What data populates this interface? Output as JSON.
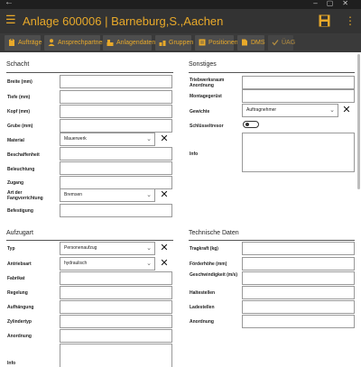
{
  "window": {
    "back_glyph": "←"
  },
  "appbar": {
    "title": "Anlage 600006  |  Barneburg,S.,Aachen"
  },
  "tabs": [
    {
      "label": "Aufträge",
      "icon": "clipboard-icon"
    },
    {
      "label": "Ansprechpartner",
      "icon": "person-icon"
    },
    {
      "label": "Anlagendaten",
      "icon": "building-icon"
    },
    {
      "label": "Gruppen",
      "icon": "group-icon"
    },
    {
      "label": "Positionen",
      "icon": "list-icon"
    },
    {
      "label": "DMS",
      "icon": "document-icon"
    },
    {
      "label": "ÜAG",
      "icon": "check-icon"
    }
  ],
  "schacht": {
    "title": "Schacht",
    "breite": "Breite (mm)",
    "tiefe": "Tiefe (mm)",
    "kopf": "Kopf (mm)",
    "grube": "Grube (mm)",
    "material": "Material",
    "material_value": "Mauerwerk",
    "beschaffenheit": "Beschaffenheit",
    "beleuchtung": "Beleuchtung",
    "zugang": "Zugang",
    "fangvorrichtung": "Art der Fangvorrichtung",
    "fangvorrichtung_value": "Bremsen",
    "befestigung": "Befestigung"
  },
  "sonstiges": {
    "title": "Sonstiges",
    "triebwerksraum": "Triebwerksraum Anordnung",
    "montagegeruest": "Montagegerüst",
    "gewichte": "Gewichte",
    "gewichte_value": "Auftragnehmer",
    "schluesseltresor": "Schlüsseltresor",
    "info": "Info"
  },
  "aufzugart": {
    "title": "Aufzugart",
    "typ": "Typ",
    "typ_value": "Personenaufzug",
    "antriebsart": "Antriebsart",
    "antriebsart_value": "hydraulisch",
    "fabrikat": "Fabrikat",
    "regelung": "Regelung",
    "aufhaengung": "Aufhängung",
    "zylindertyp": "Zylindertyp",
    "anordnung": "Anordnung",
    "info": "Info"
  },
  "technische_daten": {
    "title": "Technische Daten",
    "tragkraft": "Tragkraft (kg)",
    "foerderhoehe": "Förderhöhe (mm)",
    "geschwindigkeit": "Geschwindigkeit (m/s)",
    "haltestellen": "Haltestellen",
    "ladestellen": "Ladestellen",
    "anordnung": "Anordnung"
  },
  "colors": {
    "accent": "#e8a92a",
    "appbar": "#333333",
    "tabbar": "#3a3a3a",
    "tab": "#4d4d4d"
  }
}
